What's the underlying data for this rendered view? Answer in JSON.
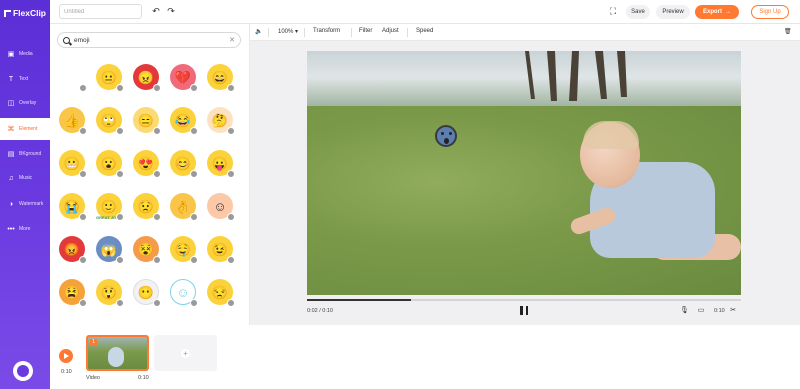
{
  "app": {
    "logo": "FlexClip"
  },
  "sidebar": {
    "items": [
      {
        "label": "Media",
        "icon": "media-icon",
        "glyph": "▣"
      },
      {
        "label": "Text",
        "icon": "text-icon",
        "glyph": "T"
      },
      {
        "label": "Overlay",
        "icon": "overlay-icon",
        "glyph": "◫"
      },
      {
        "label": "Element",
        "icon": "element-icon",
        "glyph": "⌘",
        "active": true
      },
      {
        "label": "BKground",
        "icon": "background-icon",
        "glyph": "▤"
      },
      {
        "label": "Music",
        "icon": "music-icon",
        "glyph": "♫"
      },
      {
        "label": "Watermark",
        "icon": "watermark-icon",
        "glyph": "◑"
      },
      {
        "label": "More",
        "icon": "more-icon",
        "glyph": "•••"
      }
    ]
  },
  "topbar": {
    "title_placeholder": "Untitled",
    "undo_glyph": "↶",
    "redo_glyph": "↷",
    "fullscreen_glyph": "⛶",
    "save_label": "Save",
    "preview_label": "Preview",
    "export_label": "Export",
    "export_arrow": "→",
    "signup_label": "Sign Up"
  },
  "panel": {
    "search_value": "emoji",
    "clear_glyph": "✕",
    "collapse_glyph": "‹",
    "emojis": [
      {
        "name": "loading-placeholder",
        "glyph": "",
        "bg": "transparent"
      },
      {
        "name": "neutral-face",
        "glyph": "😐",
        "bg": "#fcd23a"
      },
      {
        "name": "angry-face",
        "glyph": "😠",
        "bg": "#e23a3a"
      },
      {
        "name": "broken-heart",
        "glyph": "💔",
        "bg": "#f06a7a"
      },
      {
        "name": "grinning-face",
        "glyph": "😄",
        "bg": "#fcd23a"
      },
      {
        "name": "thumbs-up",
        "glyph": "👍",
        "bg": "#f9c64a"
      },
      {
        "name": "rolling-eyes",
        "glyph": "🙄",
        "bg": "#fcd23a"
      },
      {
        "name": "expressionless-face",
        "glyph": "😑",
        "bg": "#fcdb74"
      },
      {
        "name": "joy-face",
        "glyph": "😂",
        "bg": "#fcd23a"
      },
      {
        "name": "thinking-face",
        "glyph": "🤔",
        "bg": "#fde2c0"
      },
      {
        "name": "nervous-blob",
        "glyph": "😬",
        "bg": "#fcd23a"
      },
      {
        "name": "surprised-face",
        "glyph": "😮",
        "bg": "#fcd23a"
      },
      {
        "name": "heart-eyes",
        "glyph": "😍",
        "bg": "#fcd23a"
      },
      {
        "name": "smiling-face",
        "glyph": "😊",
        "bg": "#fcd23a"
      },
      {
        "name": "tongue-face",
        "glyph": "😛",
        "bg": "#fcd23a"
      },
      {
        "name": "crying-face",
        "glyph": "😭",
        "bg": "#fcd23a"
      },
      {
        "name": "great-emoji",
        "glyph": "🙂",
        "bg": "#fcd23a"
      },
      {
        "name": "worried-face",
        "glyph": "😟",
        "bg": "#fcd23a"
      },
      {
        "name": "ok-hand",
        "glyph": "👌",
        "bg": "#f9c64a"
      },
      {
        "name": "blushing-face",
        "glyph": "☺",
        "bg": "#fcc8a8"
      },
      {
        "name": "rage-face",
        "glyph": "😡",
        "bg": "#e23a3a"
      },
      {
        "name": "fearful-face",
        "glyph": "😱",
        "bg": "#6a8ec4"
      },
      {
        "name": "dizzy-face",
        "glyph": "😵",
        "bg": "#f59b4a"
      },
      {
        "name": "drooling-face",
        "glyph": "🤤",
        "bg": "#fcd23a"
      },
      {
        "name": "winking-face",
        "glyph": "😉",
        "bg": "#fcd23a"
      },
      {
        "name": "tired-face",
        "glyph": "😫",
        "bg": "#f6a23a"
      },
      {
        "name": "astonished-face",
        "glyph": "😲",
        "bg": "#fcd23a"
      },
      {
        "name": "blank-face",
        "glyph": "😶",
        "bg": "#f2f2f2"
      },
      {
        "name": "outline-smile",
        "glyph": "☺",
        "bg": "#ffffff"
      },
      {
        "name": "unamused-face",
        "glyph": "😒",
        "bg": "#fcd23a"
      }
    ],
    "great_text": "GREAT JOB"
  },
  "editor": {
    "toolbar": {
      "volume_glyph": "🔈",
      "zoom": "100%",
      "zoom_caret": "▾",
      "transform": "Transform",
      "filter": "Filter",
      "adjust": "Adjust",
      "speed": "Speed",
      "delete_glyph": "🗑"
    },
    "player": {
      "current_time": "0:02 / 0:10",
      "end_time": "0:10",
      "progress_fraction": 0.24,
      "mic_glyph": "🎙",
      "ratio_glyph": "▭",
      "split_glyph": "✂"
    },
    "sticker_name": "fearful-emoji-sticker"
  },
  "storyboard": {
    "total_time": "0:10",
    "clip_number": "1",
    "clip_label": "Video",
    "clip_duration": "0:10",
    "add_glyph": "+"
  },
  "colors": {
    "brand_purple": "#6a3ae0",
    "accent_orange": "#ff7a30"
  }
}
